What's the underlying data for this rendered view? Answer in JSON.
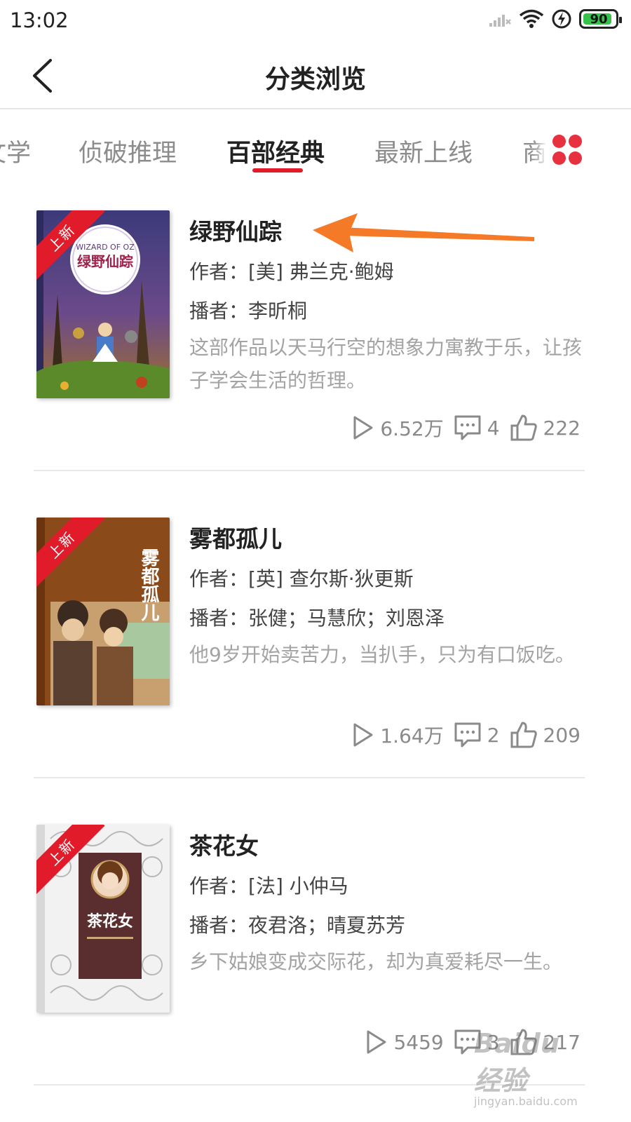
{
  "status_bar": {
    "time": "13:02",
    "battery": "90",
    "battery_level": 0.9
  },
  "header": {
    "title": "分类浏览",
    "back_icon": "chevron-left-icon"
  },
  "tabs": [
    {
      "label": "文学"
    },
    {
      "label": "侦破推理"
    },
    {
      "label": "百部经典",
      "active": true
    },
    {
      "label": "最新上线"
    },
    {
      "label": "商"
    }
  ],
  "books": [
    {
      "ribbon": "上新",
      "cover_title": "绿野仙踪",
      "cover_subtitle": "WIZARD OF OZ",
      "title": "绿野仙踪",
      "author_label": "作者：",
      "author": "[美] 弗兰克·鲍姆",
      "narrator_label": "播者：",
      "narrator": "李昕桐",
      "description": "这部作品以天马行空的想象力寓教于乐，让孩子学会生活的哲理。",
      "plays": "6.52万",
      "comments": "4",
      "likes": "222"
    },
    {
      "ribbon": "上新",
      "cover_title": "雾都孤儿",
      "title": "雾都孤儿",
      "author_label": "作者：",
      "author": "[英] 查尔斯·狄更斯",
      "narrator_label": "播者：",
      "narrator": "张健；马慧欣；刘恩泽",
      "description": "他9岁开始卖苦力，当扒手，只为有口饭吃。",
      "plays": "1.64万",
      "comments": "2",
      "likes": "209"
    },
    {
      "ribbon": "上新",
      "cover_title": "茶花女",
      "title": "茶花女",
      "author_label": "作者：",
      "author": "[法] 小仲马",
      "narrator_label": "播者：",
      "narrator": "夜君洛；晴夏苏芳",
      "description": "乡下姑娘变成交际花，却为真爱耗尽一生。",
      "plays": "5459",
      "comments": "3",
      "likes": "217"
    }
  ],
  "watermark": {
    "main": "Baidu 经验",
    "sub": "jingyan.baidu.com"
  },
  "colors": {
    "accent": "#e21b2a",
    "arrow": "#f47a27",
    "battery": "#36c24a"
  }
}
